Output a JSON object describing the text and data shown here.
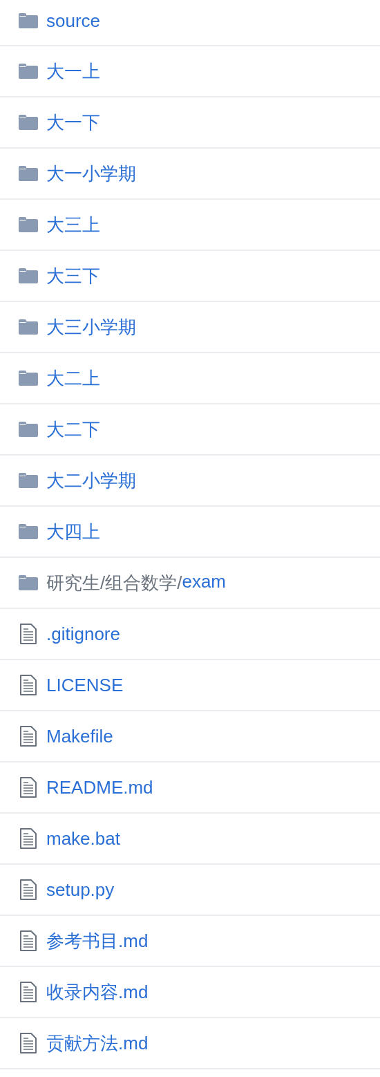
{
  "files": [
    {
      "kind": "folder",
      "name": "source"
    },
    {
      "kind": "folder",
      "name": "大一上"
    },
    {
      "kind": "folder",
      "name": "大一下"
    },
    {
      "kind": "folder",
      "name": "大一小学期"
    },
    {
      "kind": "folder",
      "name": "大三上"
    },
    {
      "kind": "folder",
      "name": "大三下"
    },
    {
      "kind": "folder",
      "name": "大三小学期"
    },
    {
      "kind": "folder",
      "name": "大二上"
    },
    {
      "kind": "folder",
      "name": "大二下"
    },
    {
      "kind": "folder",
      "name": "大二小学期"
    },
    {
      "kind": "folder",
      "name": "大四上"
    },
    {
      "kind": "folder",
      "prefix": "研究生/组合数学/",
      "name": "exam"
    },
    {
      "kind": "file",
      "name": ".gitignore"
    },
    {
      "kind": "file",
      "name": "LICENSE"
    },
    {
      "kind": "file",
      "name": "Makefile"
    },
    {
      "kind": "file",
      "name": "README.md"
    },
    {
      "kind": "file",
      "name": "make.bat"
    },
    {
      "kind": "file",
      "name": "setup.py"
    },
    {
      "kind": "file",
      "name": "参考书目.md"
    },
    {
      "kind": "file",
      "name": "收录内容.md"
    },
    {
      "kind": "file",
      "name": "贡献方法.md"
    }
  ]
}
